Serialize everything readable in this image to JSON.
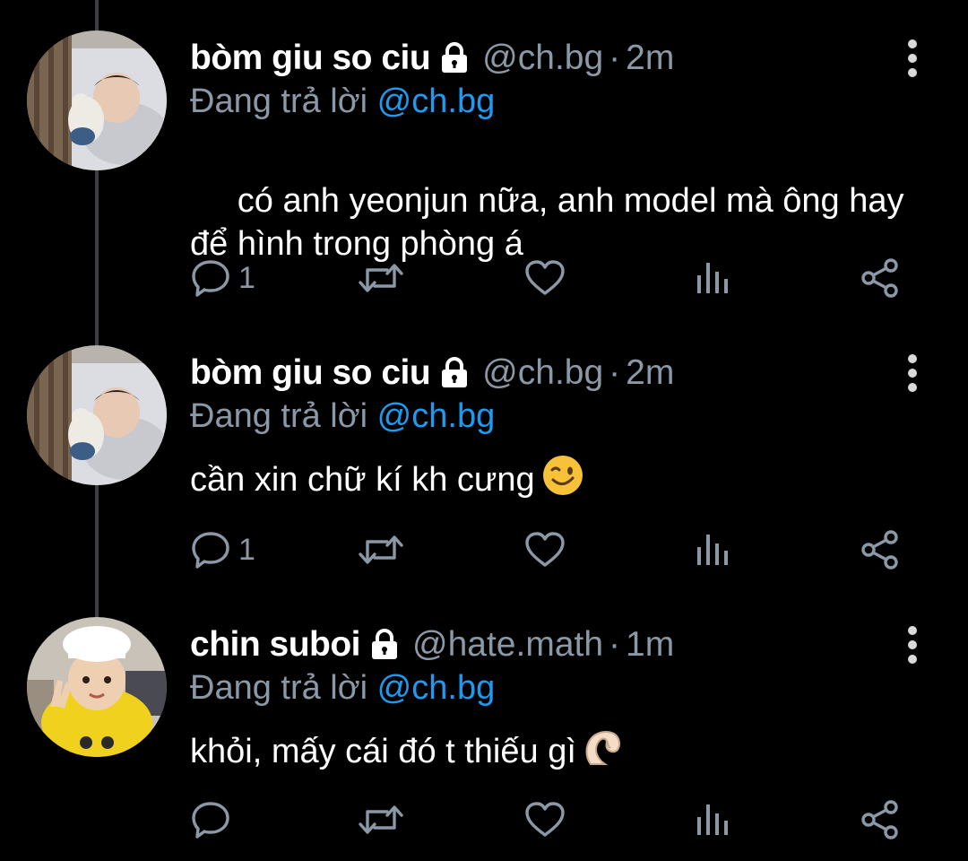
{
  "reply_prefix": "Đang trả lời",
  "tweets": [
    {
      "display_name": "bòm giu so ciu",
      "handle": "@ch.bg",
      "separator": "·",
      "time": "2m",
      "reply_to": "@ch.bg",
      "text": " có anh yeonjun nữa, anh model mà ông hay để hình trong phòng á",
      "emoji": "",
      "reply_count": "1",
      "avatar": "baby-sleeping-avatar"
    },
    {
      "display_name": "bòm giu so ciu",
      "handle": "@ch.bg",
      "separator": "·",
      "time": "2m",
      "reply_to": "@ch.bg",
      "text": "cần xin chữ kí kh cưng",
      "emoji": "winking-face-emoji",
      "reply_count": "1",
      "avatar": "baby-sleeping-avatar"
    },
    {
      "display_name": "chin suboi",
      "handle": "@hate.math",
      "separator": "·",
      "time": "1m",
      "reply_to": "@ch.bg",
      "text": "khỏi, mấy cái đó t thiếu gì",
      "emoji": "pinching-hand-emoji",
      "reply_count": "",
      "avatar": "child-chef-hat-avatar"
    }
  ],
  "colors": {
    "background": "#000000",
    "text": "#ffffff",
    "secondary": "#8b98a5",
    "mention": "#1d9bf0",
    "thread_line": "#3a3f44"
  },
  "icons": {
    "lock": "lock-icon",
    "more": "more-vertical-icon",
    "reply": "reply-icon",
    "retweet": "retweet-icon",
    "like": "heart-icon",
    "analytics": "analytics-icon",
    "share": "share-icon"
  }
}
